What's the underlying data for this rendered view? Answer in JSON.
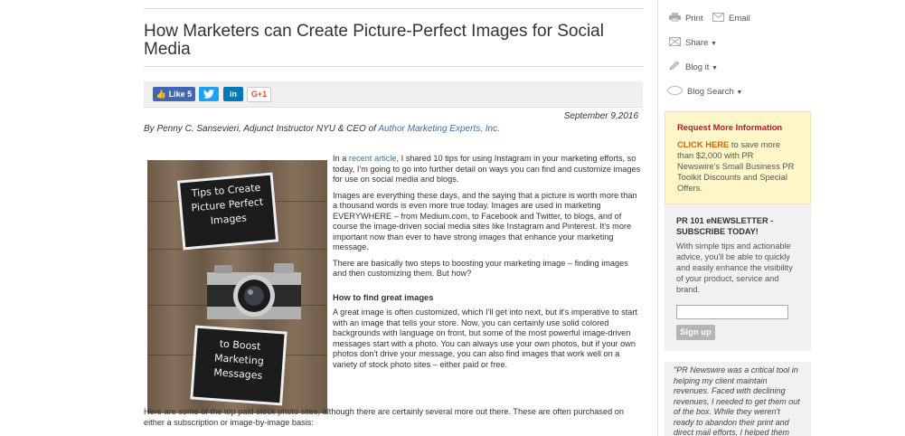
{
  "article": {
    "title": "How Marketers can Create Picture-Perfect Images for Social Media",
    "date": "September 9,2016",
    "byline_prefix": "By Penny C. Sansevieri, Adjunct Instructor NYU & CEO of ",
    "byline_link": "Author Marketing Experts, Inc.",
    "image_text": {
      "top_slate": [
        "Tips to Create",
        "Picture Perfect",
        "Images"
      ],
      "bottom_slate": [
        "to Boost",
        "Marketing",
        "Messages"
      ]
    },
    "p1_pre": "In a ",
    "p1_link": "recent article",
    "p1_post": ", I shared 10 tips for using Instagram in your marketing efforts, so today, I'm going to go into further detail on ways you can find and customize images for use on social media and blogs.",
    "p2": "Images are everything these days, and the saying that a picture is worth more than a thousand words is even more true today. Images are used in marketing EVERYWHERE – from Medium.com, to Facebook and Twitter, to blogs, and of course the image-driven social media sites like Instagram and Pinterest. It's more important now than ever to have strong images that enhance your marketing message.",
    "p3": "There are basically two steps to boosting your marketing image – finding images and then customizing them. But how?",
    "heading": "How to find great images",
    "p4": "A great image is often customized, which I'll get into next, but it's imperative to start with an image that tells your store. Now, you can certainly use solid colored backgrounds with language on front, but some of the most powerful image-driven messages start with a photo. You can always use your own photos, but if your own photos don't drive your message, you can also find images that work well on a variety of stock photo sites – either paid or free.",
    "p5": "Here are some of the top paid stock photo sites, although there are certainly several more out there. These are often purchased on either a subscription or image-by-image basis:"
  },
  "share": {
    "facebook": "Like 5",
    "twitter_icon": "twitter-icon",
    "linkedin": "in",
    "googleplus": "G+1"
  },
  "tools": {
    "print": "Print",
    "email": "Email",
    "share": "Share",
    "blog_it": "Blog it",
    "blog_search": "Blog Search"
  },
  "promo": {
    "title": "Request More Information",
    "click": "CLICK HERE",
    "text": " to save more than $2,000 with PR Newswire's Small Business PR Toolkit Discounts and Special Offers."
  },
  "newsletter": {
    "title": "PR 101 eNEWSLETTER - SUBSCRIBE TODAY!",
    "text": "With simple tips and actionable advice, you'll be able to quickly and easily enhance the visibility of your product, service and brand.",
    "input_value": "",
    "button": "Sign up"
  },
  "quote": {
    "text": "\"PR Newswire was a critical tool in helping my client maintain revenues. Faced with declining revenues, I needed to get them out of the box. While they weren't ready to abandon their print and direct mail efforts, I helped them"
  },
  "colors": {
    "link": "#3a6ea5",
    "promo_title": "#c8102e",
    "promo_click": "#d4620a",
    "facebook": "#4267b2",
    "twitter": "#1da1f2",
    "linkedin": "#0077b5"
  }
}
